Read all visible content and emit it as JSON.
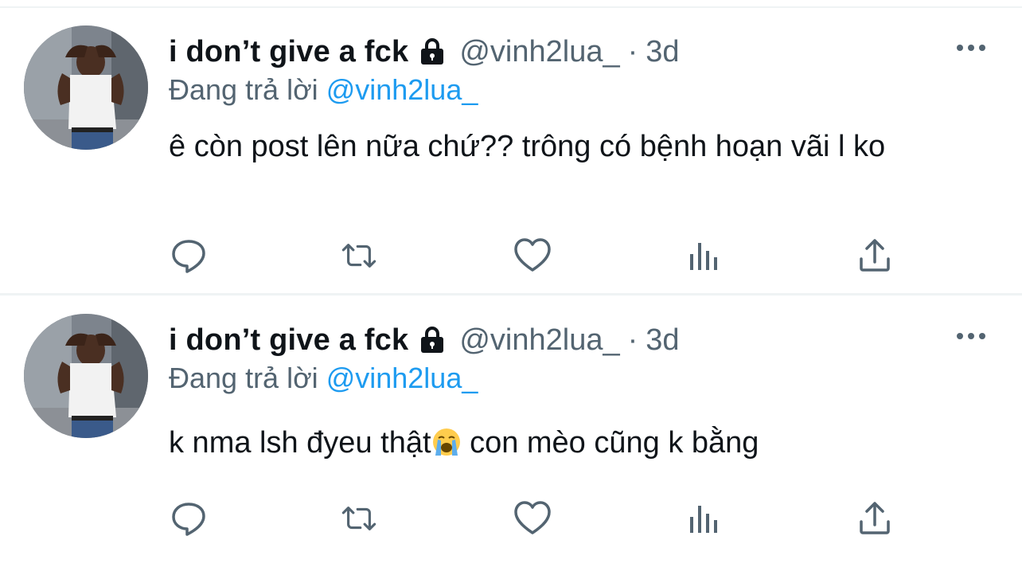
{
  "tweets": [
    {
      "display_name": "i don’t give a fck",
      "handle": "@vinh2lua_",
      "separator": "·",
      "time": "3d",
      "reply_prefix": "Đang trả lời",
      "reply_mention": "@vinh2lua_",
      "text": "ê còn post lên nữa chứ?? trông có bệnh hoạn vãi l ko"
    },
    {
      "display_name": "i don’t give a fck",
      "handle": "@vinh2lua_",
      "separator": "·",
      "time": "3d",
      "reply_prefix": "Đang trả lời",
      "reply_mention": "@vinh2lua_",
      "text_before_emoji": "k nma lsh đyeu thật",
      "emoji": "loudly-crying-face",
      "text_after_emoji": " con mèo cũng k bằng"
    }
  ],
  "icons": {
    "lock": "lock-icon",
    "more": "more-horizontal-icon",
    "reply": "reply-icon",
    "retweet": "retweet-icon",
    "like": "heart-icon",
    "views": "views-chart-icon",
    "share": "share-icon"
  },
  "colors": {
    "text": "#0f1419",
    "secondary": "#536471",
    "accent": "#1d9bf0",
    "divider": "#eff3f4"
  }
}
